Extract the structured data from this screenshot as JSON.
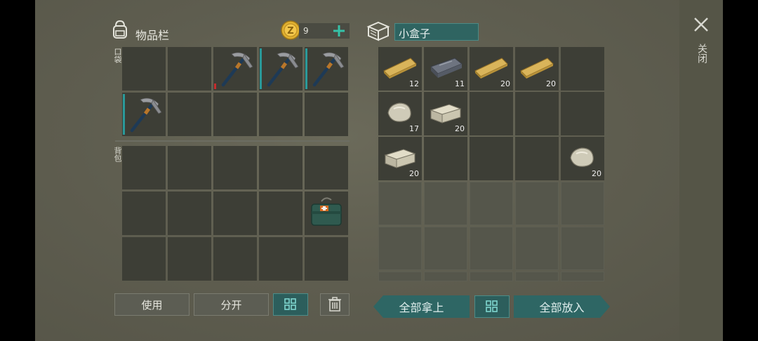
{
  "inventory": {
    "title": "物品栏",
    "coins": "9",
    "pocket_label": "口袋",
    "backpack_label": "背包",
    "pocket_items": [
      {
        "icon": "pickaxe-icon",
        "durability": "red"
      },
      {
        "icon": "pickaxe-icon",
        "durability": "teal"
      },
      {
        "icon": "pickaxe-icon",
        "durability": "teal"
      },
      {
        "icon": "pickaxe-icon",
        "durability": "teal"
      }
    ],
    "backpack_items": [
      {
        "icon": "supply-crate-icon"
      }
    ]
  },
  "container": {
    "title": "小盒子",
    "items": [
      {
        "icon": "wood-plank-icon",
        "qty": "12"
      },
      {
        "icon": "metal-bar-icon",
        "qty": "11"
      },
      {
        "icon": "wood-plank-icon",
        "qty": "20"
      },
      {
        "icon": "wood-plank-icon",
        "qty": "20"
      },
      {
        "icon": "stone-icon",
        "qty": "17"
      },
      {
        "icon": "stone-block-icon",
        "qty": "20"
      },
      {
        "icon": "stone-block-icon",
        "qty": "20"
      },
      {
        "icon": "stone-icon",
        "qty": "20"
      }
    ]
  },
  "buttons": {
    "use": "使用",
    "split": "分开",
    "take_all": "全部拿上",
    "put_all": "全部放入",
    "close": "关闭"
  },
  "colors": {
    "accent": "#2e6664",
    "coin": "#e0b030",
    "plus": "#35c2a8"
  }
}
